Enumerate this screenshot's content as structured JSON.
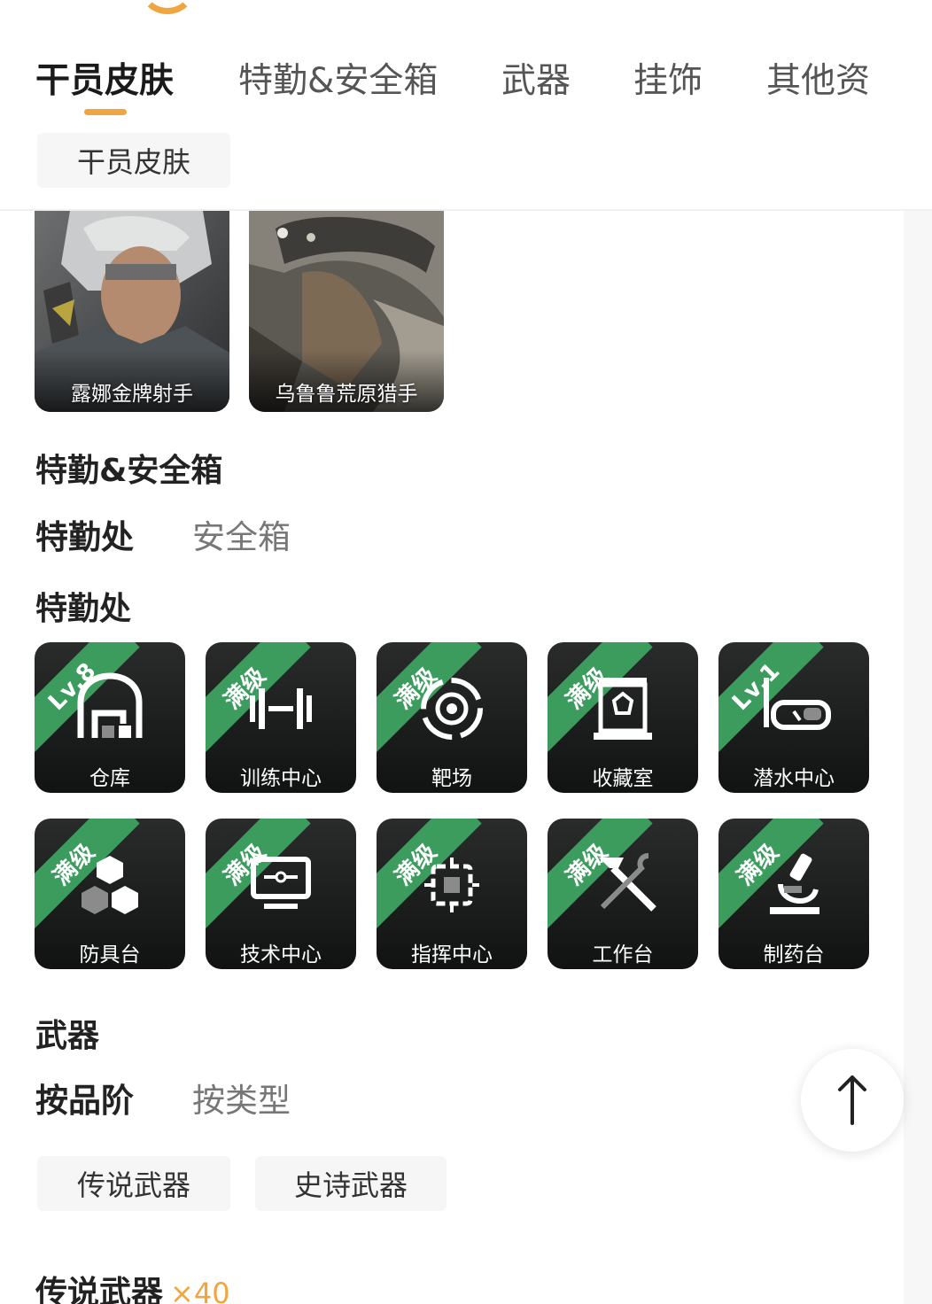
{
  "tabs": [
    {
      "label": "干员皮肤",
      "active": true
    },
    {
      "label": "特勤&安全箱"
    },
    {
      "label": "武器"
    },
    {
      "label": "挂饰"
    },
    {
      "label": "其他资"
    }
  ],
  "skins": {
    "filter_chip": "干员皮肤",
    "items": [
      {
        "name": "露娜金牌射手"
      },
      {
        "name": "乌鲁鲁荒原猎手"
      }
    ]
  },
  "special": {
    "title": "特勤&安全箱",
    "subtabs": [
      {
        "label": "特勤处",
        "active": true
      },
      {
        "label": "安全箱"
      }
    ],
    "group_title": "特勤处",
    "facilities": [
      {
        "name": "仓库",
        "badge": "Lv.8",
        "icon": "warehouse-icon"
      },
      {
        "name": "训练中心",
        "badge": "满级",
        "icon": "dumbbell-icon"
      },
      {
        "name": "靶场",
        "badge": "满级",
        "icon": "target-icon"
      },
      {
        "name": "收藏室",
        "badge": "满级",
        "icon": "display-case-icon"
      },
      {
        "name": "潜水中心",
        "badge": "Lv.1",
        "icon": "diving-mask-icon"
      },
      {
        "name": "防具台",
        "badge": "满级",
        "icon": "cubes-icon"
      },
      {
        "name": "技术中心",
        "badge": "满级",
        "icon": "monitor-icon"
      },
      {
        "name": "指挥中心",
        "badge": "满级",
        "icon": "chip-icon"
      },
      {
        "name": "工作台",
        "badge": "满级",
        "icon": "hammer-wrench-icon"
      },
      {
        "name": "制药台",
        "badge": "满级",
        "icon": "microscope-icon"
      }
    ]
  },
  "weapons": {
    "title": "武器",
    "subtabs": [
      {
        "label": "按品阶",
        "active": true
      },
      {
        "label": "按类型"
      }
    ],
    "chips": [
      "传说武器",
      "史诗武器"
    ],
    "group_title": "传说武器",
    "group_count": "×40"
  },
  "colors": {
    "accent": "#f0a640",
    "ribbon": "#3b9c5e",
    "tile_bg": "#1a1c1b"
  }
}
